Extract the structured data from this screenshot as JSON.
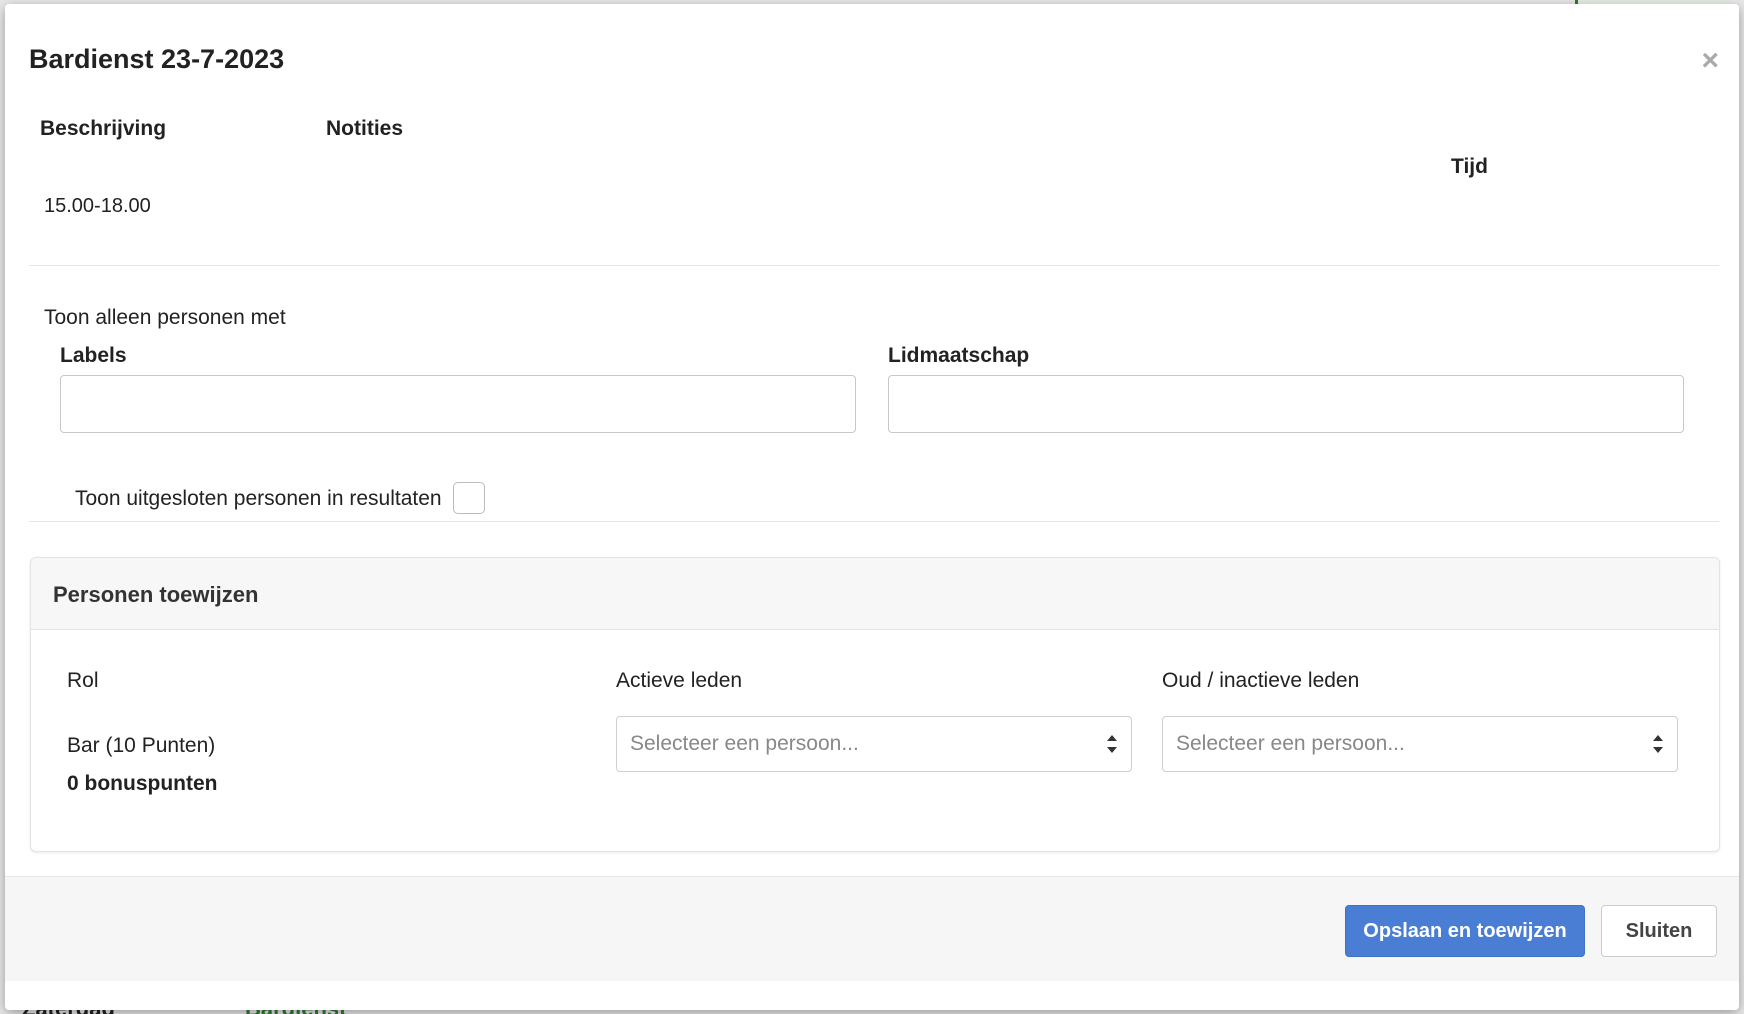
{
  "background": {
    "bottom_left_text": "Zaterdag",
    "bottom_mid_text": "Bardienst"
  },
  "modal": {
    "title": "Bardienst 23-7-2023",
    "close_glyph": "×"
  },
  "info": {
    "description_label": "Beschrijving",
    "notes_label": "Notities",
    "time_label": "Tijd",
    "time_value": "15.00-18.00"
  },
  "filter": {
    "heading": "Toon alleen personen met",
    "labels_label": "Labels",
    "labels_value": "",
    "membership_label": "Lidmaatschap",
    "membership_value": "",
    "show_excluded_label": "Toon uitgesloten personen in resultaten",
    "show_excluded_checked": false
  },
  "assign": {
    "title": "Personen toewijzen",
    "col_role": "Rol",
    "col_active": "Actieve leden",
    "col_inactive": "Oud / inactieve leden",
    "role_name": "Bar (10 Punten)",
    "role_bonus": "0 bonuspunten",
    "active_placeholder": "Selecteer een persoon...",
    "inactive_placeholder": "Selecteer een persoon..."
  },
  "footer": {
    "save_label": "Opslaan en toewijzen",
    "close_label": "Sluiten"
  },
  "colors": {
    "primary": "#4a7ed4",
    "bg_accent": "#2e7d32"
  },
  "icons": {
    "close": "close-icon",
    "select_arrows": "sort-arrows-icon",
    "checkbox": "checkbox-icon"
  }
}
